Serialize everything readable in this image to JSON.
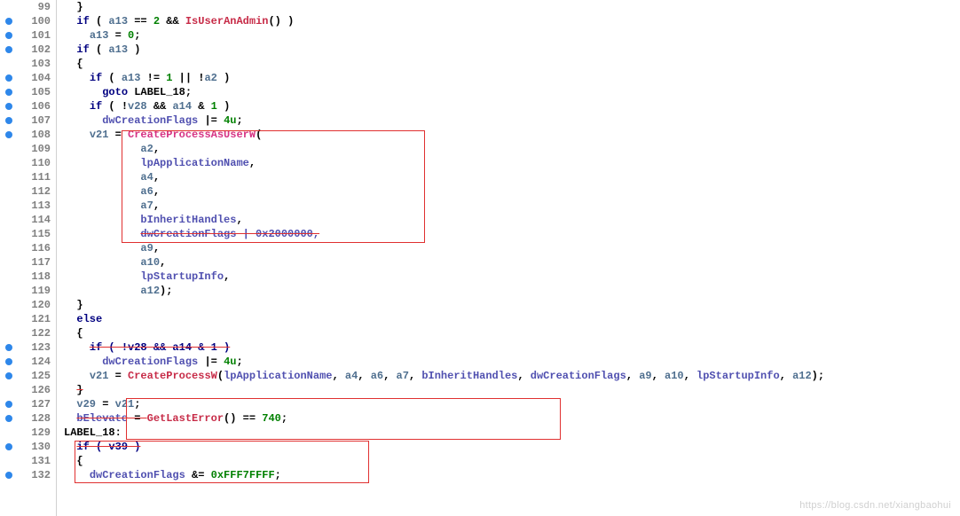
{
  "watermark": "https://blog.csdn.net/xiangbaohui",
  "lines": [
    {
      "n": 99,
      "bp": false,
      "ind": 2,
      "tokens": [
        {
          "t": "}",
          "c": "c-paren"
        }
      ]
    },
    {
      "n": 100,
      "bp": true,
      "ind": 2,
      "tokens": [
        {
          "t": "if",
          "c": "c-keyword"
        },
        {
          "t": " ( ",
          "c": "c-paren"
        },
        {
          "t": "a13",
          "c": "c-var"
        },
        {
          "t": " == ",
          "c": "c-op"
        },
        {
          "t": "2",
          "c": "c-num"
        },
        {
          "t": " && ",
          "c": "c-op"
        },
        {
          "t": "IsUserAnAdmin",
          "c": "c-func2"
        },
        {
          "t": "() )",
          "c": "c-paren"
        }
      ]
    },
    {
      "n": 101,
      "bp": true,
      "ind": 4,
      "tokens": [
        {
          "t": "a13",
          "c": "c-var"
        },
        {
          "t": " = ",
          "c": "c-op"
        },
        {
          "t": "0",
          "c": "c-num"
        },
        {
          "t": ";",
          "c": "c-paren"
        }
      ]
    },
    {
      "n": 102,
      "bp": true,
      "ind": 2,
      "tokens": [
        {
          "t": "if",
          "c": "c-keyword"
        },
        {
          "t": " ( ",
          "c": "c-paren"
        },
        {
          "t": "a13",
          "c": "c-var"
        },
        {
          "t": " )",
          "c": "c-paren"
        }
      ]
    },
    {
      "n": 103,
      "bp": false,
      "ind": 2,
      "tokens": [
        {
          "t": "{",
          "c": "c-paren"
        }
      ]
    },
    {
      "n": 104,
      "bp": true,
      "ind": 4,
      "tokens": [
        {
          "t": "if",
          "c": "c-keyword"
        },
        {
          "t": " ( ",
          "c": "c-paren"
        },
        {
          "t": "a13",
          "c": "c-var"
        },
        {
          "t": " != ",
          "c": "c-op"
        },
        {
          "t": "1",
          "c": "c-num"
        },
        {
          "t": " || !",
          "c": "c-op"
        },
        {
          "t": "a2",
          "c": "c-var"
        },
        {
          "t": " )",
          "c": "c-paren"
        }
      ]
    },
    {
      "n": 105,
      "bp": true,
      "ind": 6,
      "tokens": [
        {
          "t": "goto",
          "c": "c-keyword"
        },
        {
          "t": " LABEL_18;",
          "c": "c-label"
        }
      ]
    },
    {
      "n": 106,
      "bp": true,
      "ind": 4,
      "tokens": [
        {
          "t": "if",
          "c": "c-keyword"
        },
        {
          "t": " ( !",
          "c": "c-op"
        },
        {
          "t": "v28",
          "c": "c-var"
        },
        {
          "t": " && ",
          "c": "c-op"
        },
        {
          "t": "a14",
          "c": "c-var"
        },
        {
          "t": " & ",
          "c": "c-op"
        },
        {
          "t": "1",
          "c": "c-num"
        },
        {
          "t": " )",
          "c": "c-paren"
        }
      ]
    },
    {
      "n": 107,
      "bp": true,
      "ind": 6,
      "tokens": [
        {
          "t": "dwCreationFlags",
          "c": "c-field"
        },
        {
          "t": " |= ",
          "c": "c-op"
        },
        {
          "t": "4u",
          "c": "c-num"
        },
        {
          "t": ";",
          "c": "c-paren"
        }
      ]
    },
    {
      "n": 108,
      "bp": true,
      "ind": 4,
      "tokens": [
        {
          "t": "v21",
          "c": "c-var"
        },
        {
          "t": " = ",
          "c": "c-op"
        },
        {
          "t": "CreateProcessAsUserW",
          "c": "c-func"
        },
        {
          "t": "(",
          "c": "c-paren"
        }
      ]
    },
    {
      "n": 109,
      "bp": false,
      "ind": 12,
      "tokens": [
        {
          "t": "a2",
          "c": "c-var"
        },
        {
          "t": ",",
          "c": "c-paren"
        }
      ]
    },
    {
      "n": 110,
      "bp": false,
      "ind": 12,
      "tokens": [
        {
          "t": "lpApplicationName",
          "c": "c-field"
        },
        {
          "t": ",",
          "c": "c-paren"
        }
      ]
    },
    {
      "n": 111,
      "bp": false,
      "ind": 12,
      "tokens": [
        {
          "t": "a4",
          "c": "c-var"
        },
        {
          "t": ",",
          "c": "c-paren"
        }
      ]
    },
    {
      "n": 112,
      "bp": false,
      "ind": 12,
      "tokens": [
        {
          "t": "a6",
          "c": "c-var"
        },
        {
          "t": ",",
          "c": "c-paren"
        }
      ]
    },
    {
      "n": 113,
      "bp": false,
      "ind": 12,
      "tokens": [
        {
          "t": "a7",
          "c": "c-var"
        },
        {
          "t": ",",
          "c": "c-paren"
        }
      ]
    },
    {
      "n": 114,
      "bp": false,
      "ind": 12,
      "tokens": [
        {
          "t": "bInheritHandles",
          "c": "c-field"
        },
        {
          "t": ",",
          "c": "c-paren"
        }
      ]
    },
    {
      "n": 115,
      "bp": false,
      "ind": 12,
      "tokens": [
        {
          "t": "dwCreationFlags | 0x2000000,",
          "c": "c-field",
          "strike": true
        }
      ]
    },
    {
      "n": 116,
      "bp": false,
      "ind": 12,
      "tokens": [
        {
          "t": "a9",
          "c": "c-var"
        },
        {
          "t": ",",
          "c": "c-paren"
        }
      ]
    },
    {
      "n": 117,
      "bp": false,
      "ind": 12,
      "tokens": [
        {
          "t": "a10",
          "c": "c-var"
        },
        {
          "t": ",",
          "c": "c-paren"
        }
      ]
    },
    {
      "n": 118,
      "bp": false,
      "ind": 12,
      "tokens": [
        {
          "t": "lpStartupInfo",
          "c": "c-field"
        },
        {
          "t": ",",
          "c": "c-paren"
        }
      ]
    },
    {
      "n": 119,
      "bp": false,
      "ind": 12,
      "tokens": [
        {
          "t": "a12",
          "c": "c-var"
        },
        {
          "t": ");",
          "c": "c-paren"
        }
      ]
    },
    {
      "n": 120,
      "bp": false,
      "ind": 2,
      "tokens": [
        {
          "t": "}",
          "c": "c-paren"
        }
      ]
    },
    {
      "n": 121,
      "bp": false,
      "ind": 2,
      "tokens": [
        {
          "t": "else",
          "c": "c-keyword"
        }
      ]
    },
    {
      "n": 122,
      "bp": false,
      "ind": 2,
      "tokens": [
        {
          "t": "{",
          "c": "c-paren"
        }
      ]
    },
    {
      "n": 123,
      "bp": true,
      "ind": 4,
      "tokens": [
        {
          "t": "if ( !v28 && a14 & 1 )",
          "c": "c-keyword",
          "strike": true
        }
      ]
    },
    {
      "n": 124,
      "bp": true,
      "ind": 6,
      "tokens": [
        {
          "t": "dwCreationFlags",
          "c": "c-field"
        },
        {
          "t": " |= ",
          "c": "c-op"
        },
        {
          "t": "4u",
          "c": "c-num"
        },
        {
          "t": ";",
          "c": "c-paren"
        }
      ]
    },
    {
      "n": 125,
      "bp": true,
      "ind": 4,
      "tokens": [
        {
          "t": "v21",
          "c": "c-var"
        },
        {
          "t": " = ",
          "c": "c-op"
        },
        {
          "t": "CreateProcessW",
          "c": "c-func2"
        },
        {
          "t": "(",
          "c": "c-paren"
        },
        {
          "t": "lpApplicationName",
          "c": "c-field"
        },
        {
          "t": ", ",
          "c": "c-paren"
        },
        {
          "t": "a4",
          "c": "c-var"
        },
        {
          "t": ", ",
          "c": "c-paren"
        },
        {
          "t": "a6",
          "c": "c-var"
        },
        {
          "t": ", ",
          "c": "c-paren"
        },
        {
          "t": "a7",
          "c": "c-var"
        },
        {
          "t": ", ",
          "c": "c-paren"
        },
        {
          "t": "bInheritHandles",
          "c": "c-field"
        },
        {
          "t": ", ",
          "c": "c-paren"
        },
        {
          "t": "dwCreationFlags",
          "c": "c-field"
        },
        {
          "t": ", ",
          "c": "c-paren"
        },
        {
          "t": "a9",
          "c": "c-var"
        },
        {
          "t": ", ",
          "c": "c-paren"
        },
        {
          "t": "a10",
          "c": "c-var"
        },
        {
          "t": ", ",
          "c": "c-paren"
        },
        {
          "t": "lpStartupInfo",
          "c": "c-field"
        },
        {
          "t": ", ",
          "c": "c-paren"
        },
        {
          "t": "a12",
          "c": "c-var"
        },
        {
          "t": ");",
          "c": "c-paren"
        }
      ]
    },
    {
      "n": 126,
      "bp": false,
      "ind": 2,
      "tokens": [
        {
          "t": "}",
          "c": "c-paren",
          "strike": true
        }
      ]
    },
    {
      "n": 127,
      "bp": true,
      "ind": 2,
      "tokens": [
        {
          "t": "v29",
          "c": "c-var"
        },
        {
          "t": " = ",
          "c": "c-op"
        },
        {
          "t": "v21",
          "c": "c-var"
        },
        {
          "t": ";",
          "c": "c-paren"
        }
      ]
    },
    {
      "n": 128,
      "bp": true,
      "ind": 2,
      "tokens": [
        {
          "t": "bElevate",
          "c": "c-field",
          "strike": true
        },
        {
          "t": " = ",
          "c": "c-op",
          "strike": true
        },
        {
          "t": "GetLastError",
          "c": "c-func2"
        },
        {
          "t": "() == ",
          "c": "c-op"
        },
        {
          "t": "740",
          "c": "c-num"
        },
        {
          "t": ";",
          "c": "c-paren"
        }
      ]
    },
    {
      "n": 129,
      "bp": false,
      "ind": 0,
      "tokens": [
        {
          "t": "LABEL_18:",
          "c": "c-label"
        }
      ]
    },
    {
      "n": 130,
      "bp": true,
      "ind": 2,
      "tokens": [
        {
          "t": "if ( v39 )",
          "c": "c-keyword",
          "strike": true
        }
      ]
    },
    {
      "n": 131,
      "bp": false,
      "ind": 2,
      "tokens": [
        {
          "t": "{",
          "c": "c-paren"
        }
      ]
    },
    {
      "n": 132,
      "bp": true,
      "ind": 4,
      "tokens": [
        {
          "t": "dwCreationFlags",
          "c": "c-field"
        },
        {
          "t": " &= ",
          "c": "c-op"
        },
        {
          "t": "0xFFF7FFFF",
          "c": "c-num"
        },
        {
          "t": ";",
          "c": "c-paren"
        }
      ]
    }
  ]
}
